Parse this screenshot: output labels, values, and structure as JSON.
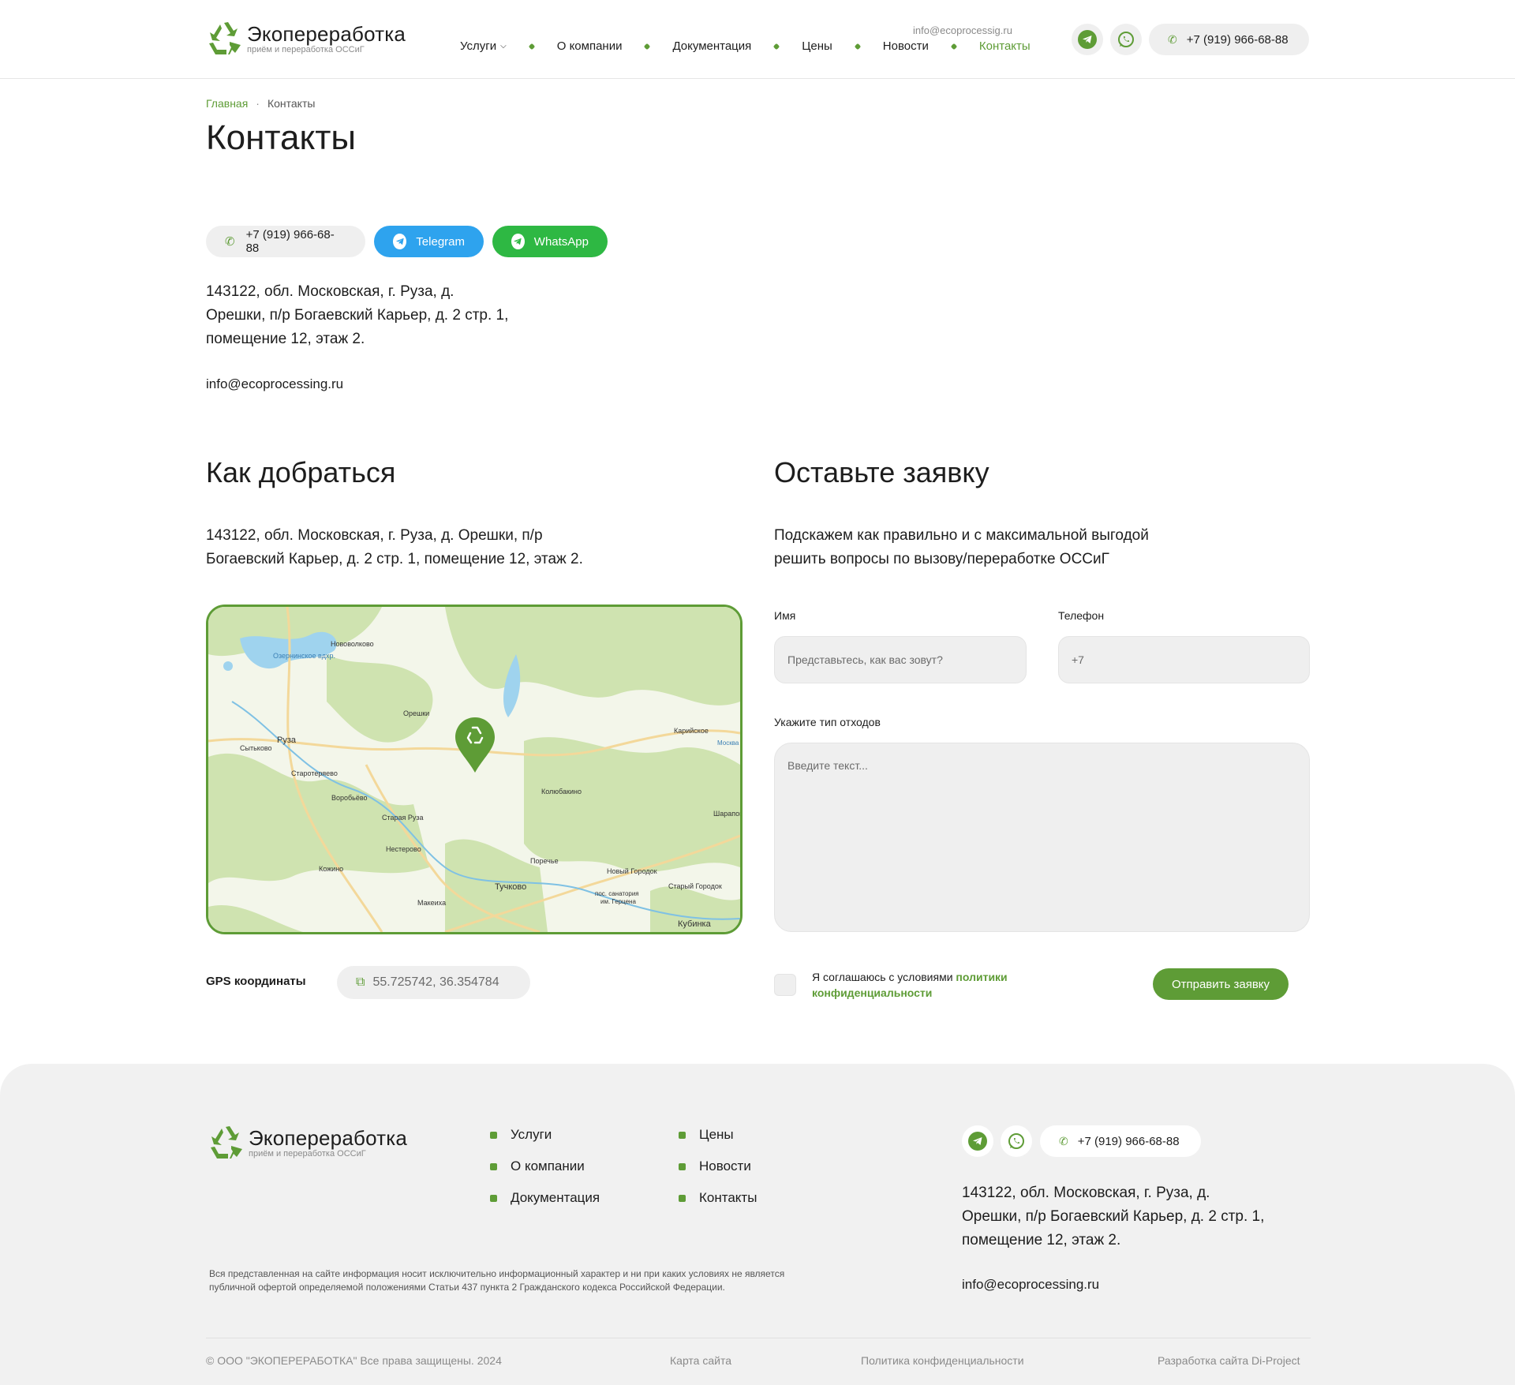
{
  "brand": {
    "name": "Экопереработка",
    "tagline": "приём и переработка ОССиГ",
    "color": "#5e9c36"
  },
  "header": {
    "email": "info@ecoprocessig.ru",
    "nav": [
      {
        "label": "Услуги"
      },
      {
        "label": "О компании"
      },
      {
        "label": "Документация"
      },
      {
        "label": "Цены"
      },
      {
        "label": "Новости"
      },
      {
        "label": "Контакты"
      }
    ],
    "phone": "+7 (919) 966-68-88"
  },
  "breadcrumb": {
    "home": "Главная",
    "current": "Контакты"
  },
  "page_title": "Контакты",
  "contact_buttons": {
    "phone": "+7 (919) 966-68-88",
    "telegram": "Telegram",
    "whatsapp": "WhatsApp"
  },
  "address": {
    "line1": "143122, обл. Московская, г. Руза, д.",
    "line2": "Орешки, п/р Богаевский Карьер, д. 2 стр. 1,",
    "line3": "помещение 12, этаж 2."
  },
  "email": "info@ecoprocessing.ru",
  "directions": {
    "title": "Как добраться",
    "line1": "143122, обл. Московская, г. Руза, д. Орешки, п/р",
    "line2": "Богаевский Карьер, д. 2 стр. 1, помещение 12, этаж 2."
  },
  "map": {
    "labels": [
      "Нововолково",
      "Озернинское вдхр.",
      "Руза",
      "Сытьково",
      "Орешки",
      "Старотеряево",
      "Воробьёво",
      "Старая Руза",
      "Нестерово",
      "Колюбакино",
      "Карийское",
      "Шарапово",
      "Поречье",
      "Новый Городок",
      "Старый Городок",
      "Кожино",
      "Тучково",
      "Макеиха",
      "пос. санатория",
      "им. Герцена",
      "Кубинка",
      "Москва"
    ]
  },
  "gps": {
    "label": "GPS координаты",
    "value": "55.725742, 36.354784"
  },
  "form": {
    "title": "Оставьте заявку",
    "lead1": "Подскажем как правильно и с максимальной выгодой",
    "lead2": "решить вопросы по вызову/переработке ОССиГ",
    "name_label": "Имя",
    "name_placeholder": "Представьтесь, как вас зовут?",
    "phone_label": "Телефон",
    "phone_placeholder": "+7",
    "waste_label": "Укажите тип отходов",
    "waste_placeholder": "Введите текст...",
    "agree_text": "Я соглашаюсь с условиями",
    "agree_link": "политики конфиденциальности",
    "submit": "Отправить заявку"
  },
  "footer": {
    "nav_col1": [
      "Услуги",
      "О компании",
      "Документация"
    ],
    "nav_col2": [
      "Цены",
      "Новости",
      "Контакты"
    ],
    "phone": "+7 (919) 966-68-88",
    "disclaimer": "Вся представленная на сайте информация носит исключительно информационный характер и ни при каких условиях не является публичной офертой определяемой положениями Статьи 437 пункта 2 Гражданского кодекса Российской Федерации.",
    "copyright": "© ООО \"ЭКОПЕРЕРАБОТКА\" Все права защищены. 2024",
    "sitemap": "Карта сайта",
    "privacy": "Политика конфиденциальности",
    "dev": "Разработка сайта Di-Project"
  }
}
